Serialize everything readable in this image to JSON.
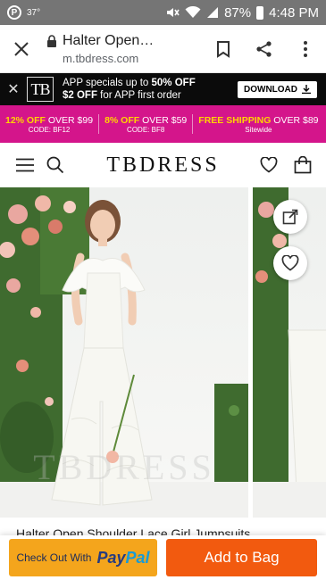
{
  "status_bar": {
    "temperature": "37°",
    "battery": "87%",
    "time": "4:48 PM"
  },
  "browser": {
    "page_title": "Halter Open…",
    "url": "m.tbdress.com"
  },
  "app_banner": {
    "logo": "TB",
    "line1_prefix": "APP specials up to ",
    "line1_bold": "50% OFF",
    "line2_bold": "$2 OFF",
    "line2_suffix": " for APP first order",
    "download_label": "DOWNLOAD"
  },
  "promos": [
    {
      "pre": "12% OFF",
      "post": " OVER $99",
      "code": "CODE: BF12"
    },
    {
      "pre": "8% OFF",
      "post": " OVER $59",
      "code": "CODE: BF8"
    },
    {
      "pre": "FREE SHIPPING",
      "post": " OVER $89",
      "code": "Sitewide"
    }
  ],
  "site": {
    "logo": "TBDRESS"
  },
  "product": {
    "watermark": "TBDRESS",
    "title": "Halter Open Shoulder Lace Girl Jumpsuits"
  },
  "actions": {
    "checkout_label": "Check Out With",
    "paypal_pay": "Pay",
    "paypal_pal": "Pal",
    "add_to_bag": "Add to Bag"
  },
  "colors": {
    "promo_bg": "#d4158b",
    "add_to_bag_bg": "#f25a0f",
    "paypal_bg": "#f4a51c"
  }
}
